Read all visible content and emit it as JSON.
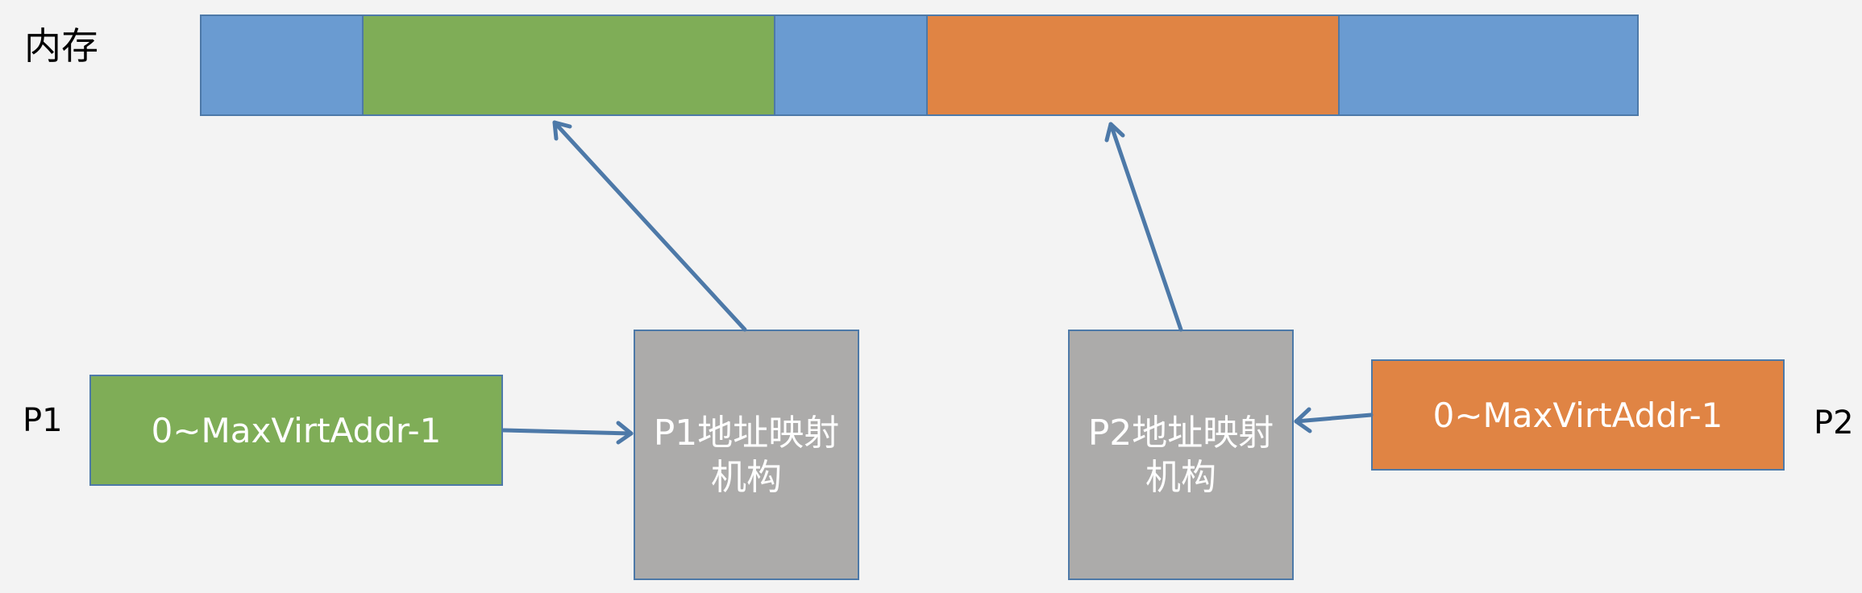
{
  "memory": {
    "label": "内存"
  },
  "processes": {
    "p1": {
      "label": "P1",
      "address_range": "0~MaxVirtAddr-1",
      "mapper": "P1地址映射机构"
    },
    "p2": {
      "label": "P2",
      "address_range": "0~MaxVirtAddr-1",
      "mapper": "P2地址映射机构"
    }
  },
  "colors": {
    "background": "#f3f3f3",
    "memory_free": "#6a9bd1",
    "p1_segment": "#7fad57",
    "p2_segment": "#e08444",
    "mapper_box": "#acabaa",
    "border_and_arrows": "#4d79a8"
  }
}
